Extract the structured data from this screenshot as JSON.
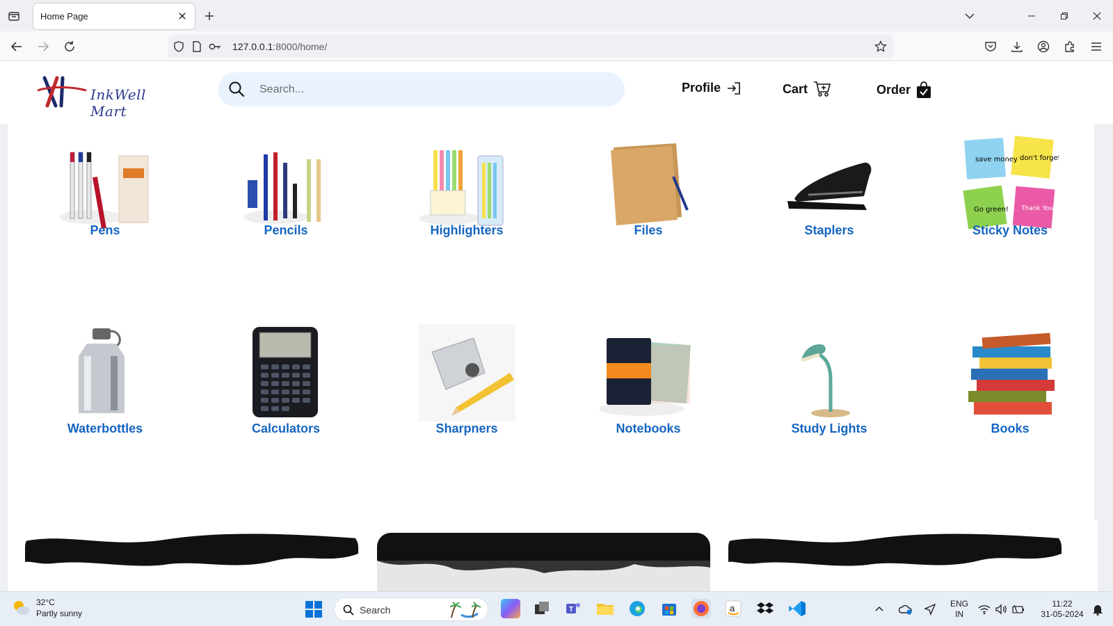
{
  "browser": {
    "tab_title": "Home Page",
    "url_host": "127.0.0.1",
    "url_rest": ":8000/home/"
  },
  "header": {
    "logo_text": "InkWell Mart",
    "search_placeholder": "Search...",
    "nav": {
      "profile": "Profile",
      "cart": "Cart",
      "order": "Order"
    }
  },
  "categories": [
    {
      "label": "Pens",
      "icon": "pens-image"
    },
    {
      "label": "Pencils",
      "icon": "pencils-image"
    },
    {
      "label": "Highlighters",
      "icon": "highlighters-image"
    },
    {
      "label": "Files",
      "icon": "files-image"
    },
    {
      "label": "Staplers",
      "icon": "staplers-image"
    },
    {
      "label": "Sticky Notes",
      "icon": "sticky-notes-image"
    },
    {
      "label": "Waterbottles",
      "icon": "waterbottles-image"
    },
    {
      "label": "Calculators",
      "icon": "calculators-image"
    },
    {
      "label": "Sharpners",
      "icon": "sharpners-image"
    },
    {
      "label": "Notebooks",
      "icon": "notebooks-image"
    },
    {
      "label": "Study Lights",
      "icon": "study-lights-image"
    },
    {
      "label": "Books",
      "icon": "books-image"
    }
  ],
  "sticky_notes_text": [
    "save money",
    "don't forget!",
    "Go green!",
    "Thank You :)"
  ],
  "taskbar": {
    "weather_temp": "32°C",
    "weather_desc": "Partly sunny",
    "search_label": "Search",
    "lang_top": "ENG",
    "lang_bottom": "IN",
    "time": "11:22",
    "date": "31-05-2024"
  },
  "colors": {
    "category_label": "#1565c0",
    "search_bg": "#eaf3fd",
    "page_bg": "#eef0f3"
  }
}
